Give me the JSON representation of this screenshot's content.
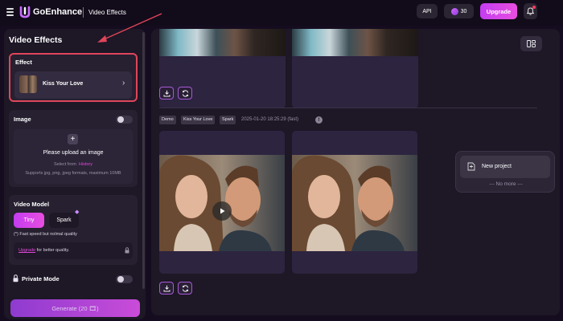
{
  "header": {
    "brand": "GoEnhance",
    "section": "Video Effects",
    "api_label": "API",
    "credits": "30",
    "upgrade_label": "Upgrade"
  },
  "left_panel": {
    "title": "Video Effects",
    "effect": {
      "label": "Effect",
      "selected": "Kiss Your Love"
    },
    "image": {
      "label": "Image",
      "toggle_on": false,
      "upload_title": "Please upload an image",
      "select_from": "Select from",
      "history_link": "History",
      "formats": "Supports jpg, png, jpeg formats, maximum 10MB"
    },
    "video_model": {
      "label": "Video Model",
      "options": [
        "Tiny",
        "Spark"
      ],
      "selected": "Tiny",
      "note": "(*) Fast speed but nolmal quality",
      "upgrade_link": "Upgrade",
      "upgrade_suffix": "for better quality."
    },
    "private_mode": {
      "label": "Private Mode",
      "toggle_on": false
    },
    "generate_label": "Generate (20 🎞)"
  },
  "main": {
    "result": {
      "tags": [
        "Demo",
        "Kiss Your Love",
        "Spark"
      ],
      "date": "2025-01-20 18:25:29 (fast)",
      "info": "!"
    }
  },
  "project_panel": {
    "new_project": "New project",
    "no_more": "--- No more ---"
  },
  "colors": {
    "accent": "#d946ef",
    "annotation": "#e0455a",
    "background": "#150d1f",
    "panel": "#1d1726"
  }
}
